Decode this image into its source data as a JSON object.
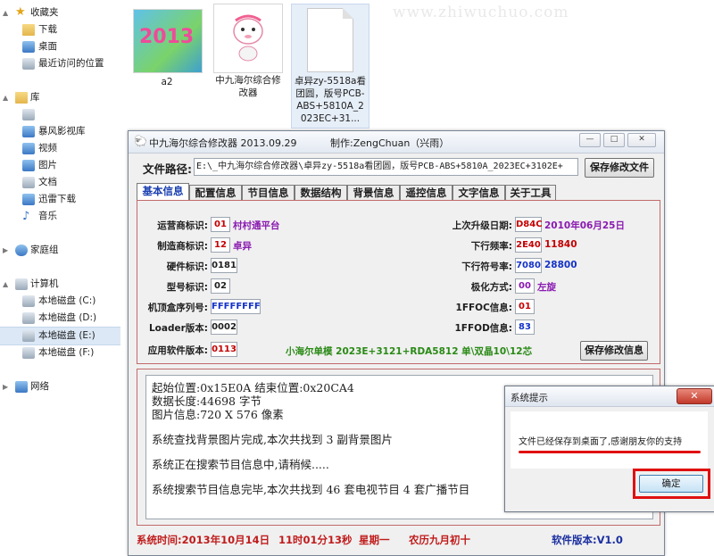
{
  "explorer": {
    "favorites_label": "收藏夹",
    "favorites": [
      "下载",
      "桌面",
      "最近访问的位置"
    ],
    "library_label": "库",
    "library": [
      "",
      "暴风影视库",
      "视频",
      "图片",
      "文档",
      "迅雷下载",
      "音乐"
    ],
    "homegroup_label": "家庭组",
    "computer_label": "计算机",
    "drives": [
      "本地磁盘 (C:)",
      "本地磁盘 (D:)",
      "本地磁盘 (E:)",
      "本地磁盘 (F:)"
    ],
    "network_label": "网络",
    "files": [
      {
        "name": "a2",
        "thumb_text": "2013"
      },
      {
        "name": "中九海尔综合修改器",
        "thumb_text": ""
      },
      {
        "name": "卓异zy-5518a看团圆，版号PCB-ABS+5810A_2023EC+31...",
        "thumb_text": ""
      }
    ],
    "watermark": "www.zhiwuchuo.com"
  },
  "app": {
    "title": "中九海尔综合修改器 2013.09.29",
    "author": "制作:ZengChuan（兴雨）",
    "path_label": "文件路径:",
    "path_value": "E:\\_中九海尔综合修改器\\卓异zy-5518a看团圆，版号PCB-ABS+5810A_2023EC+3102E+",
    "save_file_button": "保存修改文件",
    "tabs": [
      "基本信息",
      "配置信息",
      "节目信息",
      "数据结构",
      "背景信息",
      "遥控信息",
      "文字信息",
      "关于工具"
    ],
    "fields_left": [
      {
        "label": "运营商标识:",
        "box": "01",
        "value": "村村通平台"
      },
      {
        "label": "制造商标识:",
        "box": "12",
        "value": "卓异"
      },
      {
        "label": "硬件标识:",
        "box": "0181",
        "value": ""
      },
      {
        "label": "型号标识:",
        "box": "02",
        "value": ""
      },
      {
        "label": "机顶盒序列号:",
        "box": "FFFFFFFF",
        "value": ""
      },
      {
        "label": "Loader版本:",
        "box": "0002",
        "value": ""
      },
      {
        "label": "应用软件版本:",
        "box": "0113",
        "value": ""
      }
    ],
    "fields_right": [
      {
        "label": "上次升级日期:",
        "box": "D84C",
        "value": "2010年06月25日"
      },
      {
        "label": "下行频率:",
        "box": "2E40",
        "value": "11840"
      },
      {
        "label": "下行符号率:",
        "box": "7080",
        "value": "28800"
      },
      {
        "label": "极化方式:",
        "box": "00",
        "value": "左旋"
      },
      {
        "label": "1FFOC信息:",
        "box": "01",
        "value": ""
      },
      {
        "label": "1FFOD信息:",
        "box": "83",
        "value": ""
      }
    ],
    "model_text": "小海尔单模  2023E+3121+RDA5812 单\\双晶10\\12芯",
    "save_info_button": "保存修改信息",
    "log": [
      "起始位置:0x15E0A  结束位置:0x20CA4",
      "数据长度:44698 字节",
      "图片信息:720 X 576 像素",
      "系统查找背景图片完成,本次共找到 3 副背景图片",
      "系统正在搜索节目信息中,请稍候.....",
      "系统搜索节目信息完毕,本次共找到 46 套电视节目 4 套广播节目"
    ],
    "status": {
      "time_label": "系统时间:2013年10月14日",
      "clock": "11时01分13秒",
      "weekday": "星期一",
      "lunar": "农历九月初十",
      "version": "软件版本:V1.0"
    }
  },
  "dialog": {
    "title": "系统提示",
    "message": "文件已经保存到桌面了,感谢朋友你的支持",
    "ok_button": "确定"
  },
  "colors": {
    "highlight_red": "#c40000",
    "value_purple": "#8a1ab0",
    "value_green": "#2a8a16",
    "box_blue": "#1432c8"
  }
}
